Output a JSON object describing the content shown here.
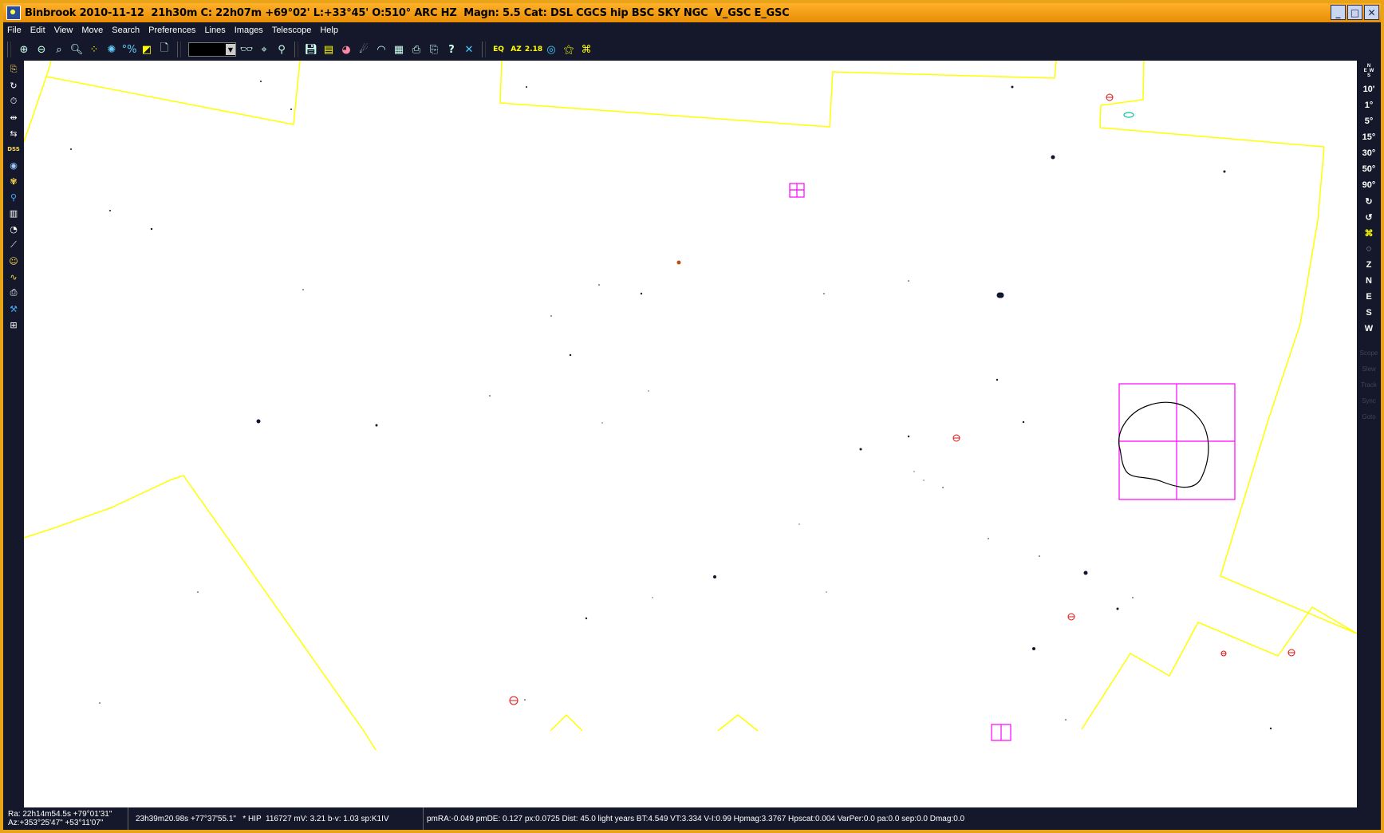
{
  "window": {
    "title": "Binbrook 2010-11-12  21h30m C: 22h07m +69°02' L:+33°45' O:510° ARC HZ  Magn: 5.5 Cat: DSL CGCS hip BSC SKY NGC  V_GSC E_GSC",
    "btn_min": "_",
    "btn_max": "□",
    "btn_close": "✕"
  },
  "menu": {
    "file": "File",
    "edit": "Edit",
    "view": "View",
    "move": "Move",
    "search": "Search",
    "preferences": "Preferences",
    "lines": "Lines",
    "images": "Images",
    "telescope": "Telescope",
    "help": "Help"
  },
  "toolbar": {
    "zoom_value": "",
    "eq_label": "EQ",
    "az_label": "AZ",
    "nmb_label": "2.18"
  },
  "rightbar": {
    "fov_10m": "10'",
    "fov_1": "1°",
    "fov_5": "5°",
    "fov_15": "15°",
    "fov_30": "30°",
    "fov_50": "50°",
    "fov_90": "90°",
    "dir_z": "Z",
    "dir_n": "N",
    "dir_e": "E",
    "dir_s": "S",
    "dir_w": "W",
    "scope": "Scope",
    "slew": "Slew",
    "track": "Track",
    "sync": "Sync",
    "goto": "Goto",
    "compass_n": "N",
    "compass_e": "E",
    "compass_w": "W",
    "compass_s": "S"
  },
  "status": {
    "ra": "Ra: 22h14m54.5s +79°01'31\"",
    "az": "Az:+353°25'47\" +53°11'07\"",
    "object": "23h39m20.98s +77°37'55.1\"   * HIP  116727 mV: 3.21 b-v: 1.03 sp:K1IV",
    "details": "pmRA:-0.049 pmDE: 0.127 px:0.0725 Dist: 45.0 light years BT:4.549 VT:3.334 V-I:0.99 Hpmag:3.3767 Hpscat:0.004 VarPer:0.0 pa:0.0 sep:0.0 Dmag:0.0"
  },
  "colors": {
    "window_border": "#e8a317",
    "chrome": "#15182a",
    "sky": "#ffffff",
    "boundary": "#ffff00",
    "marker": "#ff00ff",
    "nebula": "#ff0000",
    "galaxy": "#00c8a0",
    "star": "#101830",
    "star_orange": "#c05010"
  }
}
